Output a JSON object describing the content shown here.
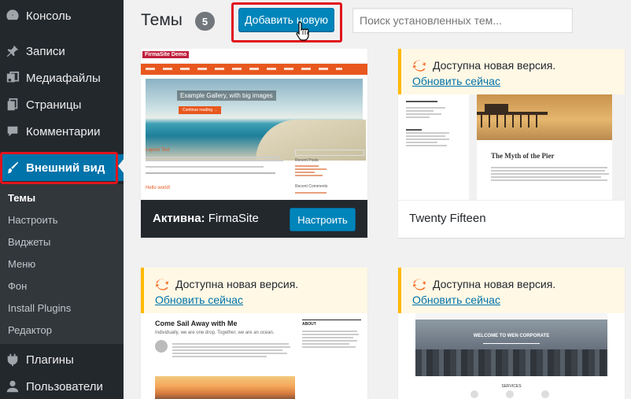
{
  "sidebar": {
    "items": [
      {
        "label": "Консоль",
        "icon": "dashboard-icon"
      },
      {
        "label": "Записи",
        "icon": "pin-icon"
      },
      {
        "label": "Медиафайлы",
        "icon": "media-icon"
      },
      {
        "label": "Страницы",
        "icon": "pages-icon"
      },
      {
        "label": "Комментарии",
        "icon": "comment-icon"
      },
      {
        "label": "Внешний вид",
        "icon": "brush-icon"
      },
      {
        "label": "Плагины",
        "icon": "plugin-icon"
      },
      {
        "label": "Пользователи",
        "icon": "user-icon"
      }
    ],
    "submenu": [
      "Темы",
      "Настроить",
      "Виджеты",
      "Меню",
      "Фон",
      "Install Plugins",
      "Редактор"
    ],
    "colors": {
      "bg": "#23282d",
      "active": "#0073aa",
      "submenu_bg": "#32373c",
      "highlight": "#e0151d"
    }
  },
  "header": {
    "title": "Темы",
    "count": "5",
    "add_button": "Добавить новую",
    "search_placeholder": "Поиск установленных тем..."
  },
  "themes": [
    {
      "active": true,
      "active_label": "Активна:",
      "name": "FirmaSite",
      "customize": "Настроить",
      "preview": {
        "site_title": "FirmaSite Demo",
        "hero_text": "Example Gallery, with big images",
        "hero_button": "Continue reading →",
        "post_title": "Layout Test",
        "post_title2": "Hello world!",
        "sidebar_heading": "Recent Posts",
        "sidebar_heading2": "Recent Comments"
      }
    },
    {
      "notice": "Доступна новая версия.",
      "update_link": "Обновить сейчас",
      "name": "Twenty Fifteen",
      "preview": {
        "post_title": "The Myth of the Pier"
      }
    },
    {
      "notice": "Доступна новая версия.",
      "update_link": "Обновить сейчас",
      "preview": {
        "post_title": "Come Sail Away with Me",
        "intro": "Individually, we are one drop. Together, we are an ocean.",
        "widget": "ABOUT"
      }
    },
    {
      "notice": "Доступна новая версия.",
      "update_link": "Обновить сейчас",
      "preview": {
        "hero_title": "WELCOME TO WEN CORPORATE",
        "section": "SERVICES"
      }
    }
  ],
  "colors": {
    "button": "#0085ba",
    "link": "#0073aa",
    "notice_border": "#ffb900",
    "notice_bg": "#fff8e5",
    "update_icon": "#f56e28"
  }
}
